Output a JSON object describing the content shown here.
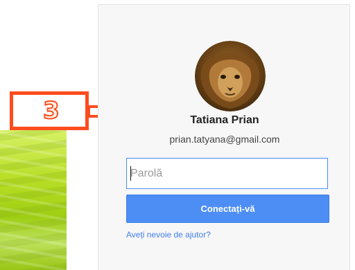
{
  "callout": {
    "number": "3"
  },
  "account": {
    "name": "Tatiana Prian",
    "email": "prian.tatyana@gmail.com"
  },
  "password": {
    "placeholder": "Parolă",
    "value": ""
  },
  "actions": {
    "signin_label": "Conectați-vă",
    "help_link": "Aveți nevoie de ajutor?"
  },
  "colors": {
    "callout": "#ff4b1f",
    "button": "#4d8ef5",
    "link": "#427fed",
    "focus": "#4d90fe"
  },
  "icons": {
    "avatar": "lion-avatar",
    "arrow": "right-arrow-outline"
  }
}
